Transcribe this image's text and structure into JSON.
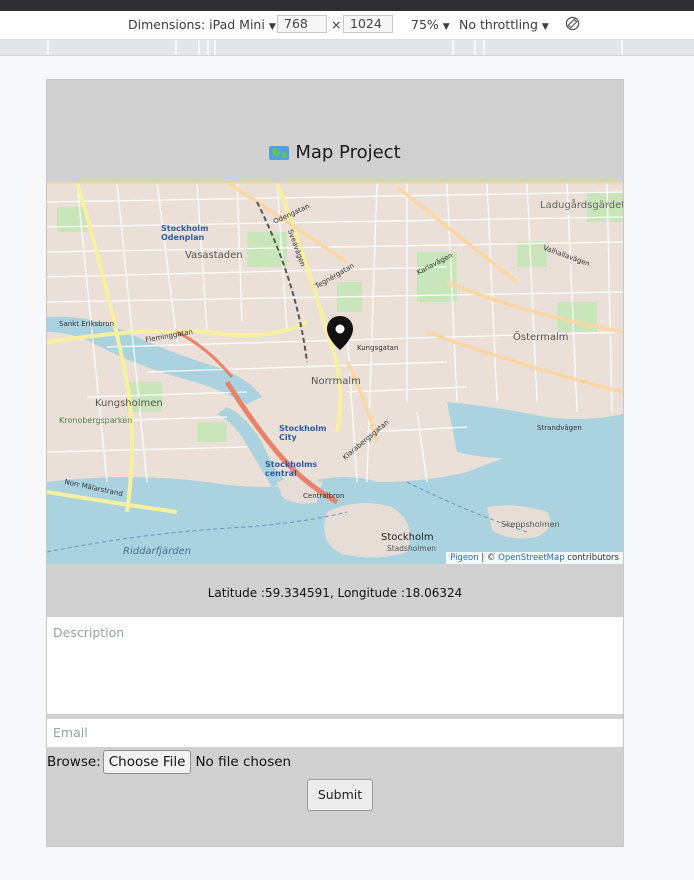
{
  "devtools": {
    "dimensions_label": "Dimensions: iPad Mini",
    "width_value": "768",
    "times": "×",
    "height_value": "1024",
    "zoom": "75%",
    "throttling": "No throttling",
    "rotate_icon": "rotate-icon"
  },
  "page": {
    "title": "Map Project",
    "title_icon": "world-map-icon"
  },
  "map": {
    "labels": {
      "stockholm_odenplan": "Stockholm Odenplan",
      "vasastaden": "Vasastaden",
      "odengatan": "Odengatan",
      "ladugardsgardet": "Ladugårdsgärdet",
      "karlavagen": "Karlavägen",
      "valhallavagen": "Valhallavägen",
      "norrmalm": "Norrmalm",
      "kungsgatan": "Kungsgatan",
      "ostermalm": "Östermalm",
      "sankt_eriksbron": "Sankt Eriksbron",
      "kungsholmen": "Kungsholmen",
      "kronobergsparken": "Kronobergsparken",
      "stockholm_city": "Stockholm City",
      "stockholms_central": "Stockholms central",
      "norr_malarstrand": "Norr Mälarstrand",
      "centralbron": "Centralbron",
      "riddarfjarden": "Riddarfjärden",
      "stockholm": "Stockholm",
      "stadsholmen": "Stadsholmen",
      "skeppsholmen": "Skeppsholmen",
      "strandvagen": "Strandvägen",
      "sveavagen": "Sveavägen",
      "tegnergatan": "Tegnérgatan",
      "klarabergsgatan": "Klarabergsgatan",
      "flemingsgatan": "Fleminggatan"
    },
    "attribution": {
      "pigeon": "Pigeon",
      "sep": " | © ",
      "osm": "OpenStreetMap",
      "contributors": " contributors"
    },
    "marker_icon": "map-pin-icon"
  },
  "location": {
    "text": "Latitude :59.334591, Longitude :18.06324"
  },
  "form": {
    "description_placeholder": "Description",
    "email_placeholder": "Email",
    "browse_label": "Browse:",
    "choose_file_label": "Choose File",
    "no_file_text": "No file chosen",
    "submit_label": "Submit"
  }
}
